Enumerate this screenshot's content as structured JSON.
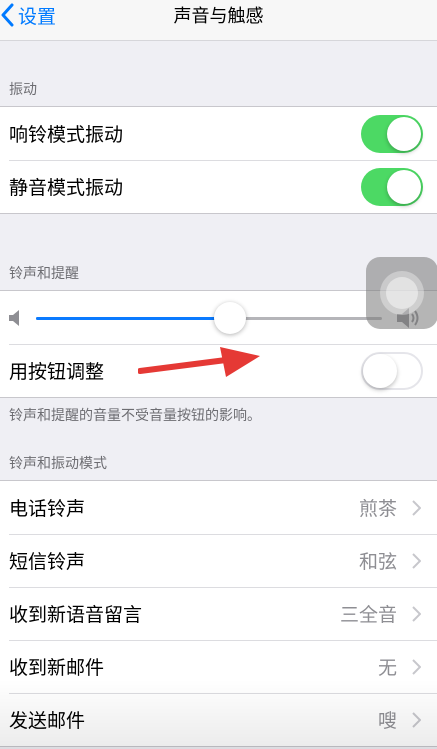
{
  "nav": {
    "back_label": "设置",
    "title": "声音与触感"
  },
  "sections": {
    "vibration": {
      "header": "振动",
      "rows": [
        {
          "label": "响铃模式振动",
          "toggle": "on"
        },
        {
          "label": "静音模式振动",
          "toggle": "on"
        }
      ]
    },
    "ringer": {
      "header": "铃声和提醒",
      "volume_level": 0.56,
      "button_adjust_label": "用按钮调整",
      "button_adjust_toggle": "off",
      "footer": "铃声和提醒的音量不受音量按钮的影响。"
    },
    "patterns": {
      "header": "铃声和振动模式",
      "rows": [
        {
          "label": "电话铃声",
          "value": "煎茶"
        },
        {
          "label": "短信铃声",
          "value": "和弦"
        },
        {
          "label": "收到新语音留言",
          "value": "三全音"
        },
        {
          "label": "收到新邮件",
          "value": "无"
        },
        {
          "label": "发送邮件",
          "value": "嗖"
        }
      ]
    }
  },
  "icons": {
    "back": "chevron-left-icon",
    "volume_low": "speaker-low-icon",
    "volume_high": "speaker-high-icon",
    "disclosure": "chevron-right-icon",
    "assistive_touch": "assistive-touch-icon",
    "annotation": "red-arrow-icon"
  },
  "colors": {
    "accent": "#007aff",
    "toggle_on": "#4cd964",
    "annotation": "#e53935",
    "background": "#efeff4"
  }
}
